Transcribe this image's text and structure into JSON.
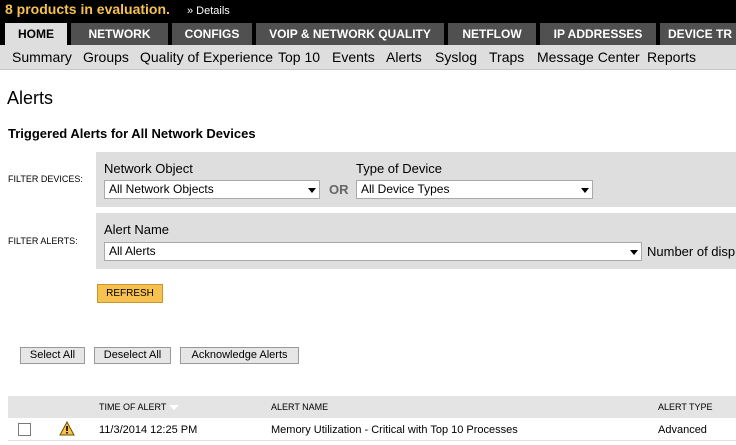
{
  "eval_bar": {
    "message": "8 products in evaluation.",
    "details_link": "» Details"
  },
  "main_tabs": [
    {
      "label": "HOME",
      "active": true
    },
    {
      "label": "NETWORK",
      "active": false
    },
    {
      "label": "CONFIGS",
      "active": false
    },
    {
      "label": "VOIP & NETWORK QUALITY",
      "active": false
    },
    {
      "label": "NETFLOW",
      "active": false
    },
    {
      "label": "IP ADDRESSES",
      "active": false
    },
    {
      "label": "DEVICE TR",
      "active": false
    }
  ],
  "sub_nav": [
    "Summary",
    "Groups",
    "Quality of Experience",
    "Top 10",
    "Events",
    "Alerts",
    "Syslog",
    "Traps",
    "Message Center",
    "Reports"
  ],
  "page_title": "Alerts",
  "section_title": "Triggered Alerts for All Network Devices",
  "filter_devices": {
    "label": "FILTER DEVICES:",
    "network_object_label": "Network Object",
    "network_object_value": "All Network Objects",
    "or_label": "OR",
    "device_type_label": "Type of Device",
    "device_type_value": "All Device Types"
  },
  "filter_alerts": {
    "label": "FILTER ALERTS:",
    "alert_name_label": "Alert Name",
    "alert_name_value": "All Alerts",
    "number_label": "Number of displ"
  },
  "refresh_label": "REFRESH",
  "actions": {
    "select_all": "Select All",
    "deselect_all": "Deselect All",
    "acknowledge": "Acknowledge Alerts"
  },
  "table": {
    "columns": [
      "TIME OF ALERT",
      "ALERT NAME",
      "ALERT TYPE"
    ],
    "rows": [
      {
        "time": "11/3/2014 12:25 PM",
        "name": "Memory Utilization - Critical with Top 10 Processes",
        "type": "Advanced",
        "icon": "warning-icon"
      }
    ]
  },
  "colors": {
    "accent": "#f6c14f",
    "tab_bg": "#505050",
    "tab_active_bg": "#dedede"
  }
}
